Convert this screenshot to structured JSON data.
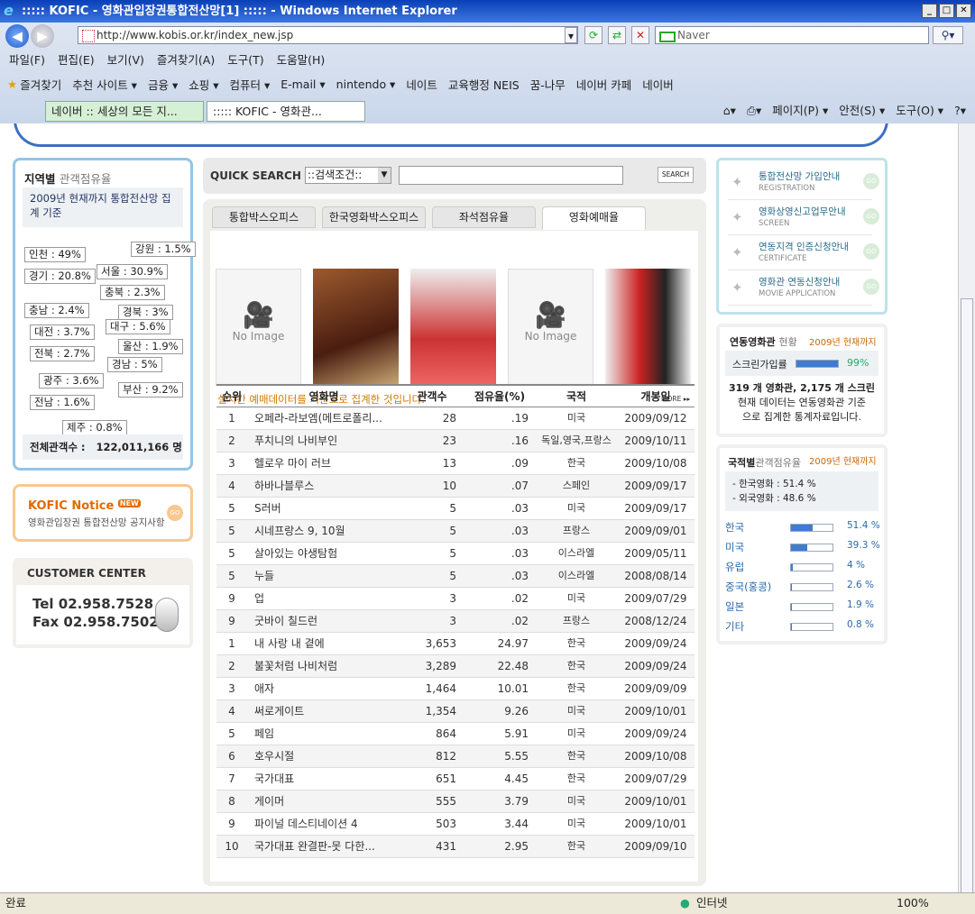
{
  "window": {
    "title": "::::: KOFIC - 영화관입장권통합전산망[1] ::::: - Windows Internet Explorer",
    "url": "http://www.kobis.or.kr/index_new.jsp",
    "search_placeholder": "Naver"
  },
  "menu": [
    "파일(F)",
    "편집(E)",
    "보기(V)",
    "즐겨찾기(A)",
    "도구(T)",
    "도움말(H)"
  ],
  "favorites": [
    "즐겨찾기",
    "추천 사이트 ▾",
    "금융 ▾",
    "쇼핑 ▾",
    "컴퓨터 ▾",
    "E-mail ▾",
    "nintendo ▾",
    "네이트",
    "교육행정 NEIS",
    "꿈-나무",
    "네이버 카페",
    "네이버"
  ],
  "browser_tabs": [
    "네이버 :: 세상의 모든 지...",
    "::::: KOFIC - 영화관..."
  ],
  "cmdbar": [
    "페이지(P) ▾",
    "안전(S) ▾",
    "도구(O) ▾"
  ],
  "status": {
    "left": "완료",
    "zone": "인터넷",
    "zoom": "100%"
  },
  "region": {
    "title": "지역별",
    "title2": "관객점유율",
    "note": "2009년 현재까지 통합전산망 집계 기준",
    "items": [
      "인천 : 49%",
      "강원 : 1.5%",
      "경기 : 20.8%",
      "서울 : 30.9%",
      "충북 : 2.3%",
      "충남 : 2.4%",
      "경북 : 3%",
      "대전 : 3.7%",
      "대구 : 5.6%",
      "울산 : 1.9%",
      "전북 : 2.7%",
      "경남 : 5%",
      "광주 : 3.6%",
      "부산 : 9.2%",
      "전남 : 1.6%",
      "제주 : 0.8%"
    ],
    "total_label": "전체관객수 :",
    "total": "122,011,166 명"
  },
  "notice": {
    "title": "KOFIC Notice",
    "badge": "NEW",
    "sub": "영화관입장권 통합전산망 공지사항",
    "go": "GO"
  },
  "customer": {
    "title": "CUSTOMER CENTER",
    "tel": "Tel  02.958.7528",
    "fax": "Fax 02.958.7502"
  },
  "quick": {
    "label": "QUICK SEARCH",
    "select": "::검색조건::",
    "button": "SEARCH"
  },
  "tabs": [
    "통합박스오피스",
    "한국영화박스오피스",
    "좌석점유율",
    "영화예매율"
  ],
  "posters": {
    "noimage": "No Image"
  },
  "notice_line": "실시간 예매데이터를 기준으로 집계한 것입니다.",
  "more": "MORE ▸▸",
  "table": {
    "headers": [
      "순위",
      "영화명",
      "관객수",
      "점유율(%)",
      "국적",
      "개봉일"
    ],
    "rows": [
      [
        "1",
        "오페라-라보엠(메트로폴리...",
        "28",
        ".19",
        "미국",
        "2009/09/12"
      ],
      [
        "2",
        "푸치니의 나비부인",
        "23",
        ".16",
        "독일,영국,프랑스",
        "2009/10/11"
      ],
      [
        "3",
        "헬로우 마이 러브",
        "13",
        ".09",
        "한국",
        "2009/10/08"
      ],
      [
        "4",
        "하바나블루스",
        "10",
        ".07",
        "스페인",
        "2009/09/17"
      ],
      [
        "5",
        "S러버",
        "5",
        ".03",
        "미국",
        "2009/09/17"
      ],
      [
        "5",
        "시네프랑스 9, 10월",
        "5",
        ".03",
        "프랑스",
        "2009/09/01"
      ],
      [
        "5",
        "살아있는 야생탐험",
        "5",
        ".03",
        "이스라엘",
        "2009/05/11"
      ],
      [
        "5",
        "누들",
        "5",
        ".03",
        "이스라엘",
        "2008/08/14"
      ],
      [
        "9",
        "업",
        "3",
        ".02",
        "미국",
        "2009/07/29"
      ],
      [
        "9",
        "굿바이 칠드런",
        "3",
        ".02",
        "프랑스",
        "2008/12/24"
      ],
      [
        "1",
        "내 사랑 내 곁에",
        "3,653",
        "24.97",
        "한국",
        "2009/09/24"
      ],
      [
        "2",
        "불꽃처럼 나비처럼",
        "3,289",
        "22.48",
        "한국",
        "2009/09/24"
      ],
      [
        "3",
        "애자",
        "1,464",
        "10.01",
        "한국",
        "2009/09/09"
      ],
      [
        "4",
        "써로게이트",
        "1,354",
        "9.26",
        "미국",
        "2009/10/01"
      ],
      [
        "5",
        "페임",
        "864",
        "5.91",
        "미국",
        "2009/09/24"
      ],
      [
        "6",
        "호우시절",
        "812",
        "5.55",
        "한국",
        "2009/10/08"
      ],
      [
        "7",
        "국가대표",
        "651",
        "4.45",
        "한국",
        "2009/07/29"
      ],
      [
        "8",
        "게이머",
        "555",
        "3.79",
        "미국",
        "2009/10/01"
      ],
      [
        "9",
        "파이널 데스티네이션 4",
        "503",
        "3.44",
        "미국",
        "2009/10/01"
      ],
      [
        "10",
        "국가대표 완결판-못 다한...",
        "431",
        "2.95",
        "한국",
        "2009/09/10"
      ]
    ]
  },
  "links": [
    {
      "t": "통합전산망 가입안내",
      "s": "REGISTRATION"
    },
    {
      "t": "영화상영신고업무안내",
      "s": "SCREEN"
    },
    {
      "t": "연동지격 인증신청안내",
      "s": "CERTIFICATE"
    },
    {
      "t": "영화관 연동신청안내",
      "s": "MOVIE APPLICATION"
    }
  ],
  "linked": {
    "title": "연동영화관",
    "title2": "현황",
    "period": "2009년 현재까지",
    "screen_label": "스크린가입률",
    "screen_pct": "99%",
    "screen_frac": 0.99,
    "line1": "319 개 영화관, 2,175 개 스크린",
    "line2": "현재 데이터는 연동영화관 기준",
    "line3": "으로 집계한 통계자료입니다."
  },
  "nation": {
    "title": "국적별",
    "title2": "관객점유율",
    "period": "2009년 현재까지",
    "kr": "- 한국영화  :   51.4 %",
    "fr": "- 외국영화  :   48.6 %",
    "items": [
      {
        "n": "한국",
        "p": "51.4 %",
        "v": 0.514
      },
      {
        "n": "미국",
        "p": "39.3 %",
        "v": 0.393
      },
      {
        "n": "유럽",
        "p": "4 %",
        "v": 0.04
      },
      {
        "n": "중국(홍콩)",
        "p": "2.6 %",
        "v": 0.026
      },
      {
        "n": "일본",
        "p": "1.9 %",
        "v": 0.019
      },
      {
        "n": "기타",
        "p": "0.8 %",
        "v": 0.008
      }
    ]
  }
}
